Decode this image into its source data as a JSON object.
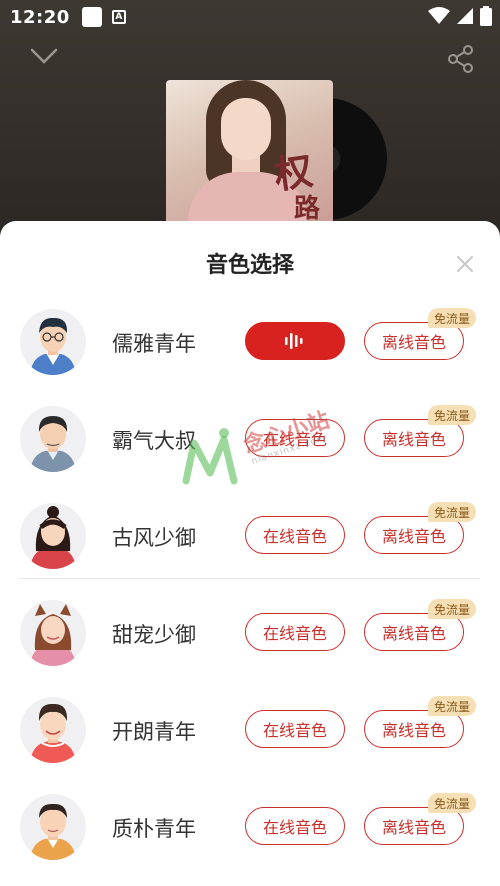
{
  "status_bar": {
    "time": "12:20",
    "a_icon_text": "A"
  },
  "album": {
    "cover_chars": [
      "权",
      "路"
    ]
  },
  "sheet": {
    "title": "音色选择",
    "badge_text": "免流量",
    "online_label": "在线音色",
    "offline_label": "离线音色",
    "voices": [
      {
        "name": "儒雅青年",
        "online_active": true
      },
      {
        "name": "霸气大叔",
        "online_active": false
      },
      {
        "name": "古风少御",
        "online_active": false
      },
      {
        "name": "甜宠少御",
        "online_active": false
      },
      {
        "name": "开朗青年",
        "online_active": false
      },
      {
        "name": "质朴青年",
        "online_active": false
      }
    ]
  },
  "watermark": {
    "text": "念心小站",
    "sub": "nianxinxz.com"
  },
  "colors": {
    "accent": "#d8221f",
    "badge_bg": "#f6dfb4",
    "badge_text": "#8a5a1b"
  }
}
